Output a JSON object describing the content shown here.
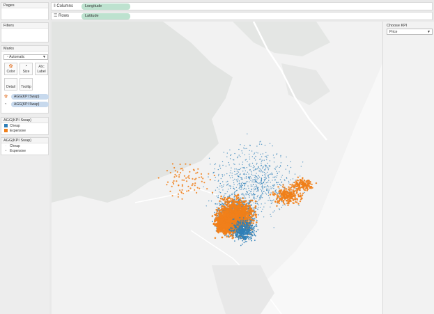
{
  "cards": {
    "pages": "Pages",
    "filters": "Filters",
    "marks": "Marks"
  },
  "marks": {
    "type_value": "Automatic",
    "buttons": [
      {
        "label": "Color",
        "icon": "color-icon"
      },
      {
        "label": "Size",
        "icon": "size-icon"
      },
      {
        "label": "Label",
        "icon": "label-icon"
      },
      {
        "label": "Detail",
        "icon": "detail-icon"
      },
      {
        "label": "Tooltip",
        "icon": "tooltip-icon"
      }
    ],
    "pills": [
      {
        "label": "AGG(KPI Swap)",
        "icon": "color-icon"
      },
      {
        "label": "AGG(KPI Swap)",
        "icon": "size-icon"
      }
    ]
  },
  "legend_color": {
    "title": "AGG(KPI Swap)",
    "items": [
      {
        "label": "Cheap",
        "color": "#1f77b4"
      },
      {
        "label": "Expensive",
        "color": "#f28e2b"
      }
    ]
  },
  "legend_size": {
    "title": "AGG(KPI Swap)",
    "items": [
      {
        "label": "Cheap",
        "size": "small"
      },
      {
        "label": "Expensive",
        "size": "large"
      }
    ]
  },
  "shelves": {
    "columns_label": "Columns",
    "columns_pill": "Longitude",
    "rows_label": "Rows",
    "rows_pill": "Latitude"
  },
  "kpi": {
    "title": "Choose KPI",
    "value": "Price"
  },
  "colors": {
    "cheap": "#2e7fb8",
    "expensive": "#f07f1a",
    "land": "#ebebeb",
    "water": "#f7f7f7",
    "pill_blue": "#c7d9ed",
    "pill_green": "#bde2cf"
  }
}
